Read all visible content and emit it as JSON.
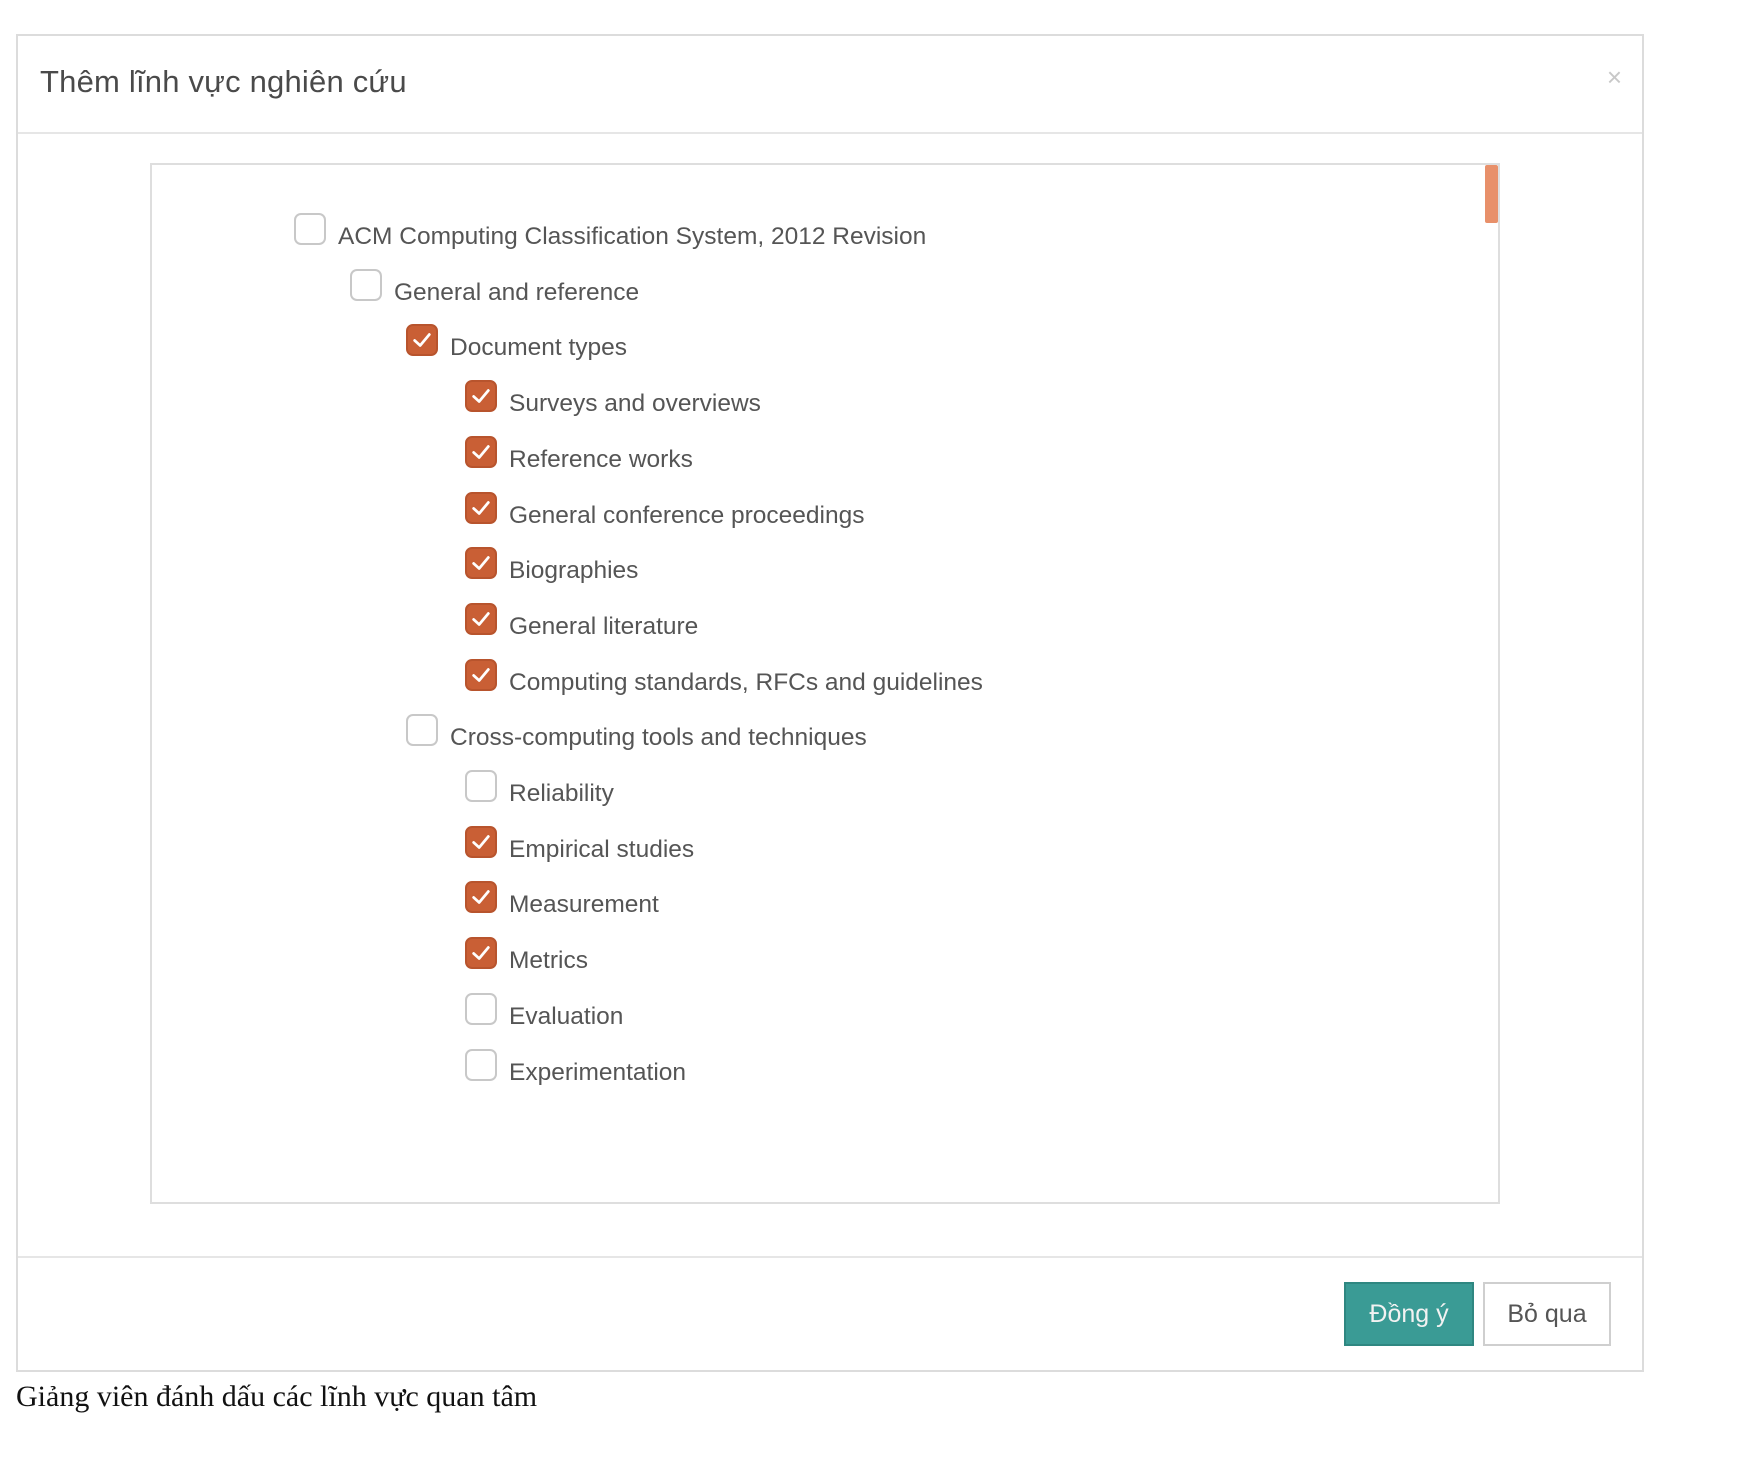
{
  "dialog": {
    "title": "Thêm lĩnh vực nghiên cứu",
    "close_label": "×"
  },
  "tree": {
    "items": [
      {
        "label": "ACM Computing Classification System, 2012 Revision",
        "level": 0,
        "checked": false
      },
      {
        "label": "General and reference",
        "level": 1,
        "checked": false
      },
      {
        "label": "Document types",
        "level": 2,
        "checked": true
      },
      {
        "label": "Surveys and overviews",
        "level": 3,
        "checked": true
      },
      {
        "label": "Reference works",
        "level": 3,
        "checked": true
      },
      {
        "label": "General conference proceedings",
        "level": 3,
        "checked": true
      },
      {
        "label": "Biographies",
        "level": 3,
        "checked": true
      },
      {
        "label": "General literature",
        "level": 3,
        "checked": true
      },
      {
        "label": "Computing standards, RFCs and guidelines",
        "level": 3,
        "checked": true
      },
      {
        "label": "Cross-computing tools and techniques",
        "level": 2,
        "checked": false
      },
      {
        "label": "Reliability",
        "level": 3,
        "checked": false
      },
      {
        "label": "Empirical studies",
        "level": 3,
        "checked": true
      },
      {
        "label": "Measurement",
        "level": 3,
        "checked": true
      },
      {
        "label": "Metrics",
        "level": 3,
        "checked": true
      },
      {
        "label": "Evaluation",
        "level": 3,
        "checked": false
      },
      {
        "label": "Experimentation",
        "level": 3,
        "checked": false
      }
    ]
  },
  "footer": {
    "confirm_label": "Đồng ý",
    "cancel_label": "Bỏ qua"
  },
  "caption": "Giảng viên đánh dấu các lĩnh vực quan tâm",
  "colors": {
    "checkbox_checked": "#c95f35",
    "primary_button": "#3a9b95",
    "scroll_thumb": "#e8906a"
  }
}
